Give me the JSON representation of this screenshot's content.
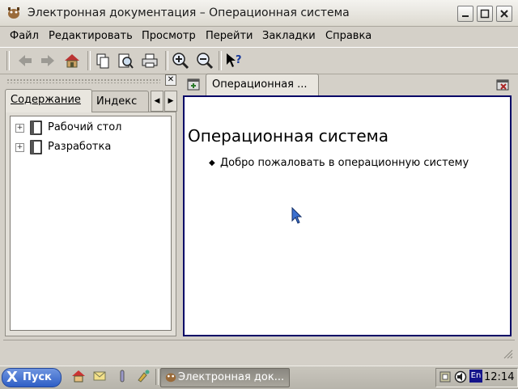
{
  "window": {
    "title": "Электронная документация – Операционная система"
  },
  "menu": [
    {
      "label": "Файл"
    },
    {
      "label": "Редактировать"
    },
    {
      "label": "Просмотр"
    },
    {
      "label": "Перейти"
    },
    {
      "label": "Закладки"
    },
    {
      "label": "Справка"
    }
  ],
  "toolbar": {
    "icons": [
      "back-icon",
      "forward-icon",
      "home-icon",
      "copy-icon",
      "find-icon",
      "print-icon",
      "zoom-in-icon",
      "zoom-out-icon",
      "context-help-icon"
    ]
  },
  "sidebar": {
    "tabs": [
      {
        "label": "Содержание"
      },
      {
        "label": "Индекс"
      }
    ],
    "tree": [
      {
        "label": "Рабочий стол"
      },
      {
        "label": "Разработка"
      }
    ]
  },
  "document": {
    "tab_label": "Операционная ...",
    "heading": "Операционная система",
    "items": [
      "Добро пожаловать в операционную систему"
    ]
  },
  "taskbar": {
    "start_label": "Пуск",
    "task_label": "Электронная док...",
    "lang": "En",
    "clock": "12:14"
  },
  "colors": {
    "accent": "#000066",
    "start": "#2f5fc6"
  }
}
